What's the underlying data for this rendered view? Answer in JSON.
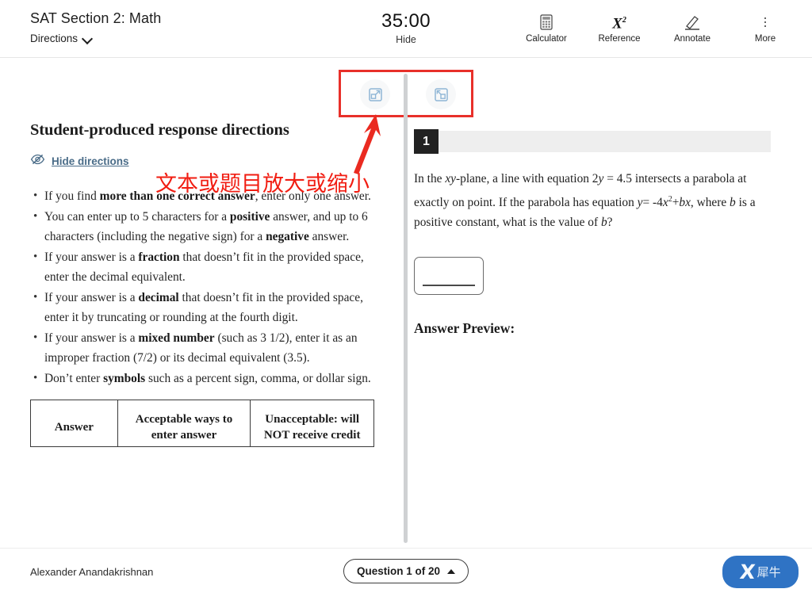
{
  "header": {
    "title": "SAT Section 2: Math",
    "directions_label": "Directions",
    "timer_value": "35:00",
    "timer_hide_label": "Hide",
    "tools": [
      {
        "label": "Calculator",
        "icon": "calculator-icon"
      },
      {
        "label": "Reference",
        "icon": "reference-x-squared-icon",
        "glyph": "X",
        "glyph_sup": "2"
      },
      {
        "label": "Annotate",
        "icon": "annotate-pencil-icon"
      },
      {
        "label": "More",
        "icon": "more-vertical-dots-icon"
      }
    ]
  },
  "zoom_controls": {
    "zoom_in_button": "expand-panel-icon",
    "zoom_out_button": "collapse-panel-icon"
  },
  "left_panel": {
    "heading": "Student-produced response directions",
    "hide_directions_label": "Hide directions",
    "hide_directions_icon": "eye-slash-icon",
    "bullets": [
      {
        "pre": "If you find ",
        "bold": "more than one correct answer",
        "post": ", enter only one answer."
      },
      {
        "pre": "You can enter up to 5 characters for a ",
        "bold": "positive",
        "post": " answer, and up to 6 characters (including the negative sign) for a ",
        "bold2": "negative",
        "post2": " answer."
      },
      {
        "pre": " If your answer is a ",
        "bold": "fraction",
        "post": " that doesn’t fit in the provided space, enter the decimal equivalent."
      },
      {
        "pre": " If your answer is a ",
        "bold": "decimal",
        "post": " that doesn’t fit in the provided space, enter it by truncating or rounding at the fourth digit."
      },
      {
        "pre": " If your answer is a ",
        "bold": "mixed number",
        "post": " (such as 3 1/2), enter it as an improper fraction (7/2) or its decimal equivalent (3.5)."
      },
      {
        "pre": "Don’t enter ",
        "bold": "symbols",
        "post": " such as a percent sign, comma, or dollar sign."
      }
    ],
    "table": {
      "headers": [
        "Answer",
        "Acceptable ways to enter answer",
        "Unacceptable: will NOT receive credit"
      ]
    }
  },
  "right_panel": {
    "question_number": "1",
    "question_text_parts": {
      "p1": "In the ",
      "i1": "xy",
      "p2": "-plane, a line with equation 2",
      "i2": "y",
      "p3": " = 4.5 intersects a parabola at exactly on point. If the parabola has equation ",
      "i3": "y",
      "p4": "= -4",
      "i4": "x",
      "sup1": "2",
      "p5": "+",
      "i5": "bx",
      "p6": ", where ",
      "i6": "b",
      "p7": " is a positive constant, what is the value of ",
      "i7": "b",
      "p8": "?"
    },
    "answer_value": "",
    "answer_placeholder": "",
    "answer_preview_label": "Answer Preview:"
  },
  "annotation": {
    "text": "文本或题目放大或缩小",
    "color": "#f11d12",
    "arrow": "up-right-arrow"
  },
  "footer": {
    "student_name": "Alexander Anandakrishnan",
    "question_nav_label": "Question 1 of 20",
    "brand_mark": "X",
    "brand_text": "犀牛"
  }
}
